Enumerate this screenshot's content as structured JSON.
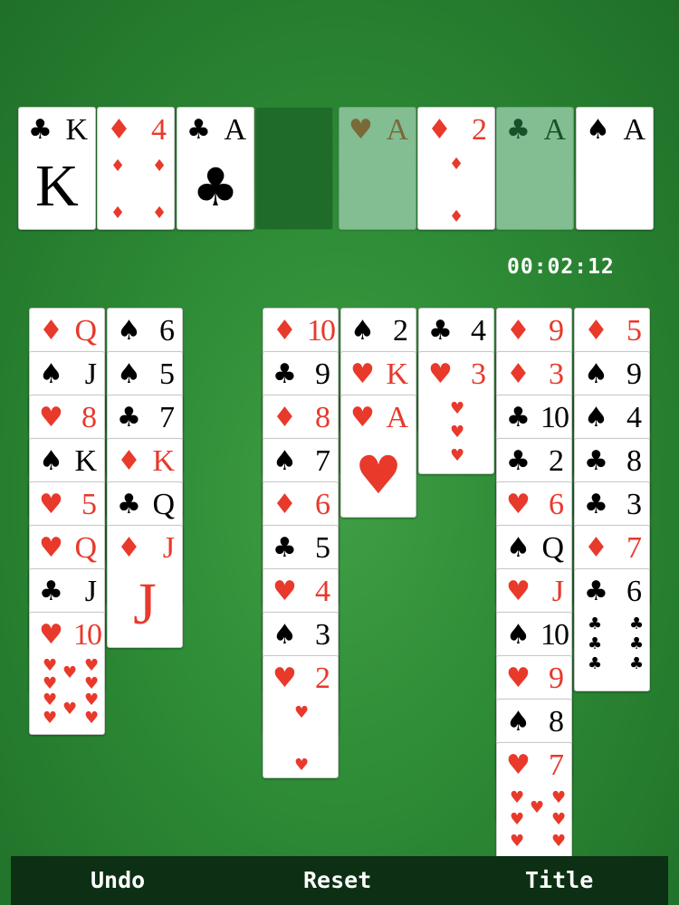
{
  "timer": "00:02:12",
  "free_cells": [
    {
      "rank": "K",
      "suit": "♣",
      "color": "black",
      "face": "K"
    },
    {
      "rank": "4",
      "suit": "♦",
      "color": "red",
      "pips": 4
    },
    {
      "rank": "A",
      "suit": "♣",
      "color": "black",
      "ace": true
    },
    null
  ],
  "foundations": [
    {
      "rank": "A",
      "suit": "♥",
      "color": "red",
      "dim": true
    },
    {
      "rank": "2",
      "suit": "♦",
      "color": "red",
      "pips": 2
    },
    {
      "rank": "A",
      "suit": "♣",
      "color": "black",
      "dim": true
    },
    {
      "rank": "A",
      "suit": "♠",
      "color": "black"
    }
  ],
  "tableau": [
    [
      {
        "rank": "Q",
        "suit": "♦",
        "color": "red"
      },
      {
        "rank": "J",
        "suit": "♠",
        "color": "black"
      },
      {
        "rank": "8",
        "suit": "♥",
        "color": "red"
      },
      {
        "rank": "K",
        "suit": "♠",
        "color": "black"
      },
      {
        "rank": "5",
        "suit": "♥",
        "color": "red"
      },
      {
        "rank": "Q",
        "suit": "♥",
        "color": "red"
      },
      {
        "rank": "J",
        "suit": "♣",
        "color": "black"
      },
      {
        "rank": "10",
        "suit": "♥",
        "color": "red",
        "pips": 10
      }
    ],
    [
      {
        "rank": "6",
        "suit": "♠",
        "color": "black"
      },
      {
        "rank": "5",
        "suit": "♠",
        "color": "black"
      },
      {
        "rank": "7",
        "suit": "♣",
        "color": "black"
      },
      {
        "rank": "K",
        "suit": "♦",
        "color": "red"
      },
      {
        "rank": "Q",
        "suit": "♣",
        "color": "black"
      },
      {
        "rank": "J",
        "suit": "♦",
        "color": "red",
        "face": "J"
      }
    ],
    [],
    [
      {
        "rank": "10",
        "suit": "♦",
        "color": "red"
      },
      {
        "rank": "9",
        "suit": "♣",
        "color": "black"
      },
      {
        "rank": "8",
        "suit": "♦",
        "color": "red"
      },
      {
        "rank": "7",
        "suit": "♠",
        "color": "black"
      },
      {
        "rank": "6",
        "suit": "♦",
        "color": "red"
      },
      {
        "rank": "5",
        "suit": "♣",
        "color": "black"
      },
      {
        "rank": "4",
        "suit": "♥",
        "color": "red"
      },
      {
        "rank": "3",
        "suit": "♠",
        "color": "black"
      },
      {
        "rank": "2",
        "suit": "♥",
        "color": "red",
        "pips": 2
      }
    ],
    [
      {
        "rank": "2",
        "suit": "♠",
        "color": "black"
      },
      {
        "rank": "K",
        "suit": "♥",
        "color": "red"
      },
      {
        "rank": "A",
        "suit": "♥",
        "color": "red",
        "ace": true
      }
    ],
    [
      {
        "rank": "4",
        "suit": "♣",
        "color": "black"
      },
      {
        "rank": "3",
        "suit": "♥",
        "color": "red",
        "pips": 3
      }
    ],
    [
      {
        "rank": "9",
        "suit": "♦",
        "color": "red"
      },
      {
        "rank": "3",
        "suit": "♦",
        "color": "red"
      },
      {
        "rank": "10",
        "suit": "♣",
        "color": "black"
      },
      {
        "rank": "2",
        "suit": "♣",
        "color": "black"
      },
      {
        "rank": "6",
        "suit": "♥",
        "color": "red"
      },
      {
        "rank": "Q",
        "suit": "♠",
        "color": "black"
      },
      {
        "rank": "J",
        "suit": "♥",
        "color": "red"
      },
      {
        "rank": "10",
        "suit": "♠",
        "color": "black"
      },
      {
        "rank": "9",
        "suit": "♥",
        "color": "red"
      },
      {
        "rank": "8",
        "suit": "♠",
        "color": "black"
      },
      {
        "rank": "7",
        "suit": "♥",
        "color": "red",
        "pips": 7
      }
    ],
    [
      {
        "rank": "5",
        "suit": "♦",
        "color": "red"
      },
      {
        "rank": "9",
        "suit": "♠",
        "color": "black"
      },
      {
        "rank": "4",
        "suit": "♠",
        "color": "black"
      },
      {
        "rank": "8",
        "suit": "♣",
        "color": "black"
      },
      {
        "rank": "3",
        "suit": "♣",
        "color": "black"
      },
      {
        "rank": "7",
        "suit": "♦",
        "color": "red"
      },
      {
        "rank": "6",
        "suit": "♣",
        "color": "black",
        "pips": 6
      }
    ]
  ],
  "bottom_bar": {
    "undo_label": "Undo",
    "reset_label": "Reset",
    "title_label": "Title"
  }
}
